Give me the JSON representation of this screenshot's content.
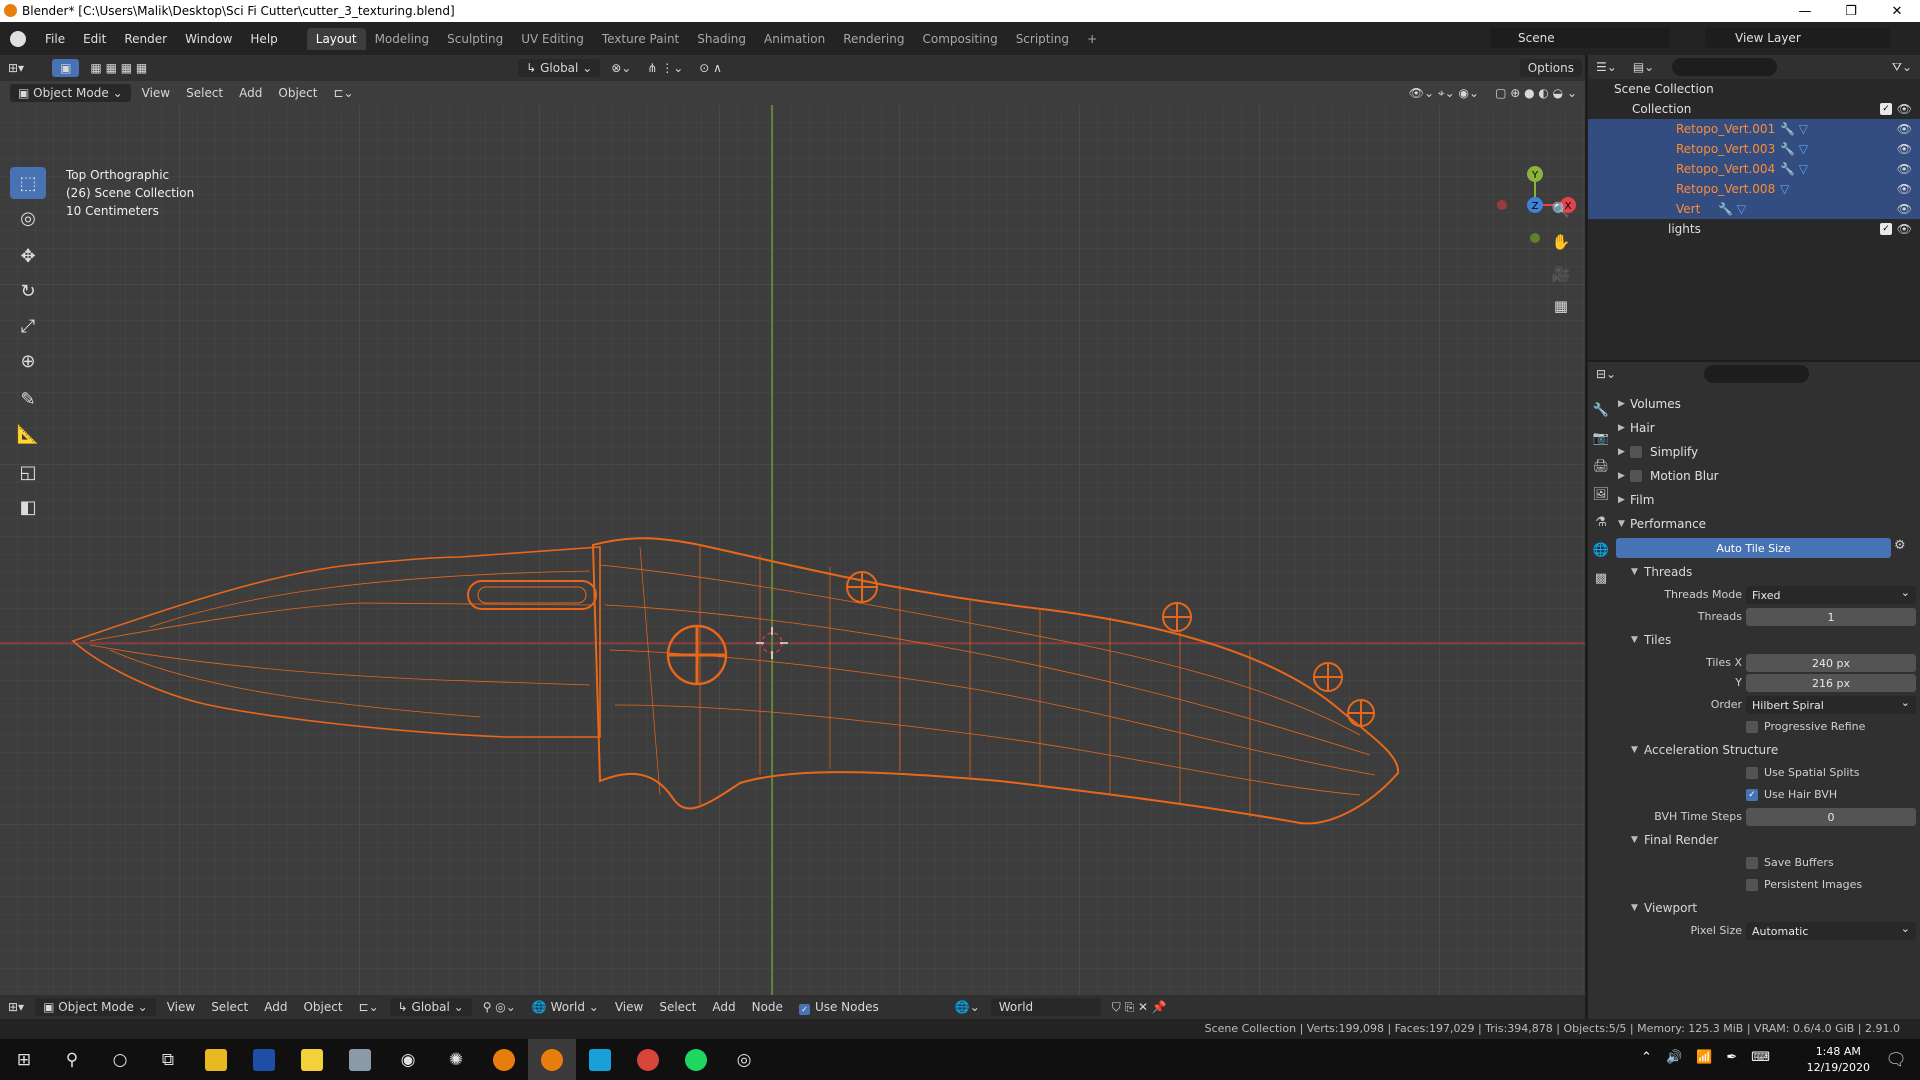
{
  "window": {
    "title": "Blender* [C:\\Users\\Malik\\Desktop\\Sci Fi Cutter\\cutter_3_texturing.blend]",
    "minimize": "—",
    "maximize": "❐",
    "close": "✕"
  },
  "menus": [
    "File",
    "Edit",
    "Render",
    "Window",
    "Help"
  ],
  "workspaces": [
    {
      "label": "Layout",
      "active": true
    },
    {
      "label": "Modeling"
    },
    {
      "label": "Sculpting"
    },
    {
      "label": "UV Editing"
    },
    {
      "label": "Texture Paint"
    },
    {
      "label": "Shading"
    },
    {
      "label": "Animation"
    },
    {
      "label": "Rendering"
    },
    {
      "label": "Compositing"
    },
    {
      "label": "Scripting"
    }
  ],
  "add_workspace": "+",
  "scene": "Scene",
  "view_layer": "View Layer",
  "viewport": {
    "mode": "Object Mode",
    "menus": [
      "View",
      "Select",
      "Add",
      "Object"
    ],
    "transform_orientation": "Global",
    "options": "Options",
    "overlay_lines": [
      "Top Orthographic",
      "(26) Scene Collection",
      "10 Centimeters"
    ],
    "gizmo_axes": {
      "y": "Y",
      "z": "Z",
      "x": "X"
    }
  },
  "toolbar_tools": [
    {
      "name": "select-box",
      "glyph": "⬚",
      "active": true
    },
    {
      "name": "cursor",
      "glyph": "◎"
    },
    {
      "name": "move",
      "glyph": "✥"
    },
    {
      "name": "rotate",
      "glyph": "↻"
    },
    {
      "name": "scale",
      "glyph": "⤢"
    },
    {
      "name": "transform",
      "glyph": "⊕"
    },
    {
      "name": "annotate",
      "glyph": "✎"
    },
    {
      "name": "measure",
      "glyph": "📐"
    },
    {
      "name": "add-cube",
      "glyph": "◱"
    },
    {
      "name": "add-plane",
      "glyph": "◧"
    }
  ],
  "outliner": {
    "root": "Scene Collection",
    "collection": "Collection",
    "objects": [
      {
        "name": "Retopo_Vert.001",
        "mods": "🔧 ▽"
      },
      {
        "name": "Retopo_Vert.003",
        "mods": "🔧 ▽"
      },
      {
        "name": "Retopo_Vert.004",
        "mods": "🔧 ▽"
      },
      {
        "name": "Retopo_Vert.008",
        "mods": "▽"
      },
      {
        "name": "Vert",
        "mods": "🔧 ▽"
      }
    ],
    "lights": "lights"
  },
  "properties": {
    "panels_closed": [
      "Volumes",
      "Hair"
    ],
    "panels_checkbox": [
      "Simplify",
      "Motion Blur"
    ],
    "film": "Film",
    "performance": "Performance",
    "auto_tile_size": "Auto Tile Size",
    "threads_section": "Threads",
    "threads_mode_label": "Threads Mode",
    "threads_mode": "Fixed",
    "threads_label": "Threads",
    "threads": "1",
    "tiles_section": "Tiles",
    "tiles_x_label": "Tiles X",
    "tiles_x": "240 px",
    "tiles_y_label": "Y",
    "tiles_y": "216 px",
    "order_label": "Order",
    "order": "Hilbert Spiral",
    "progressive_refine": "Progressive Refine",
    "accel_section": "Acceleration Structure",
    "use_spatial_splits": "Use Spatial Splits",
    "use_hair_bvh": "Use Hair BVH",
    "bvh_time_steps_label": "BVH Time Steps",
    "bvh_time_steps": "0",
    "final_render_section": "Final Render",
    "save_buffers": "Save Buffers",
    "persistent_images": "Persistent Images",
    "viewport_section": "Viewport",
    "pixel_size_label": "Pixel Size",
    "pixel_size": "Automatic"
  },
  "bottom_editor": {
    "mode": "Object Mode",
    "menus": [
      "View",
      "Select",
      "Add",
      "Object"
    ],
    "orientation": "Global",
    "world_label": "World",
    "node_menus": [
      "View",
      "Select",
      "Add",
      "Node"
    ],
    "use_nodes": "Use Nodes",
    "world_field": "World"
  },
  "status_bar": "Scene Collection | Verts:199,098 | Faces:197,029 | Tris:394,878 | Objects:5/5 | Memory: 125.3 MiB | VRAM: 0.6/4.0 GiB | 2.91.0",
  "taskbar": {
    "time": "1:48 AM",
    "date": "12/19/2020"
  },
  "colors": {
    "accent": "#4772b3",
    "object_orange": "#e8671a",
    "viewport_bg": "#3d3d3d"
  }
}
